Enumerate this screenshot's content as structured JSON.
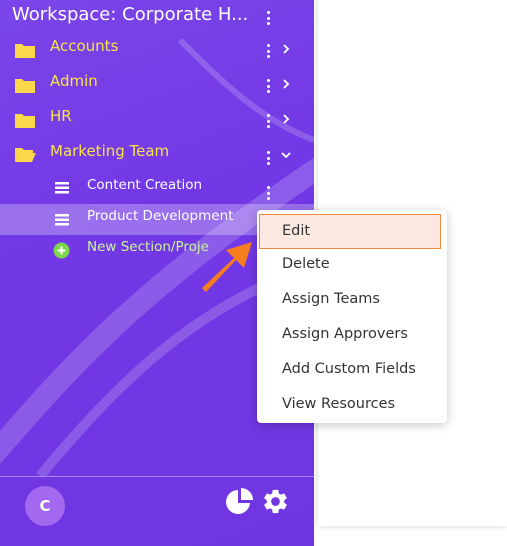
{
  "workspace": {
    "title": "Workspace: Corporate H..."
  },
  "folders": [
    {
      "label": "Accounts",
      "expanded": false
    },
    {
      "label": "Admin",
      "expanded": false
    },
    {
      "label": "HR",
      "expanded": false
    },
    {
      "label": "Marketing Team",
      "expanded": true
    }
  ],
  "sub_items": [
    {
      "label": "Content Creation"
    },
    {
      "label": "Product Development"
    }
  ],
  "new_item": {
    "label": "New Section/Proje"
  },
  "context_menu": {
    "items": [
      {
        "label": "Edit"
      },
      {
        "label": "Delete"
      },
      {
        "label": "Assign Teams"
      },
      {
        "label": "Assign Approvers"
      },
      {
        "label": "Add Custom Fields"
      },
      {
        "label": "View Resources"
      }
    ]
  },
  "footer": {
    "avatar_initial": "C"
  },
  "icons": {
    "folder": "folder-icon",
    "folder_open": "folder-open-icon",
    "list": "list-icon",
    "add": "plus-circle-icon",
    "pie": "pie-chart-icon",
    "settings": "gear-icon",
    "kebab": "kebab-icon",
    "chevron_right": "chevron-right-icon",
    "chevron_down": "chevron-down-icon"
  },
  "colors": {
    "sidebar_bg": "#7338e6",
    "folder_label": "#f7e44a",
    "folder_icon": "#f9d94a",
    "new_item": "#c8f59a",
    "add_icon": "#7bd64a",
    "highlight_border": "#f08a3c",
    "highlight_bg": "#fbe9e1",
    "arrow": "#f57c1f"
  }
}
